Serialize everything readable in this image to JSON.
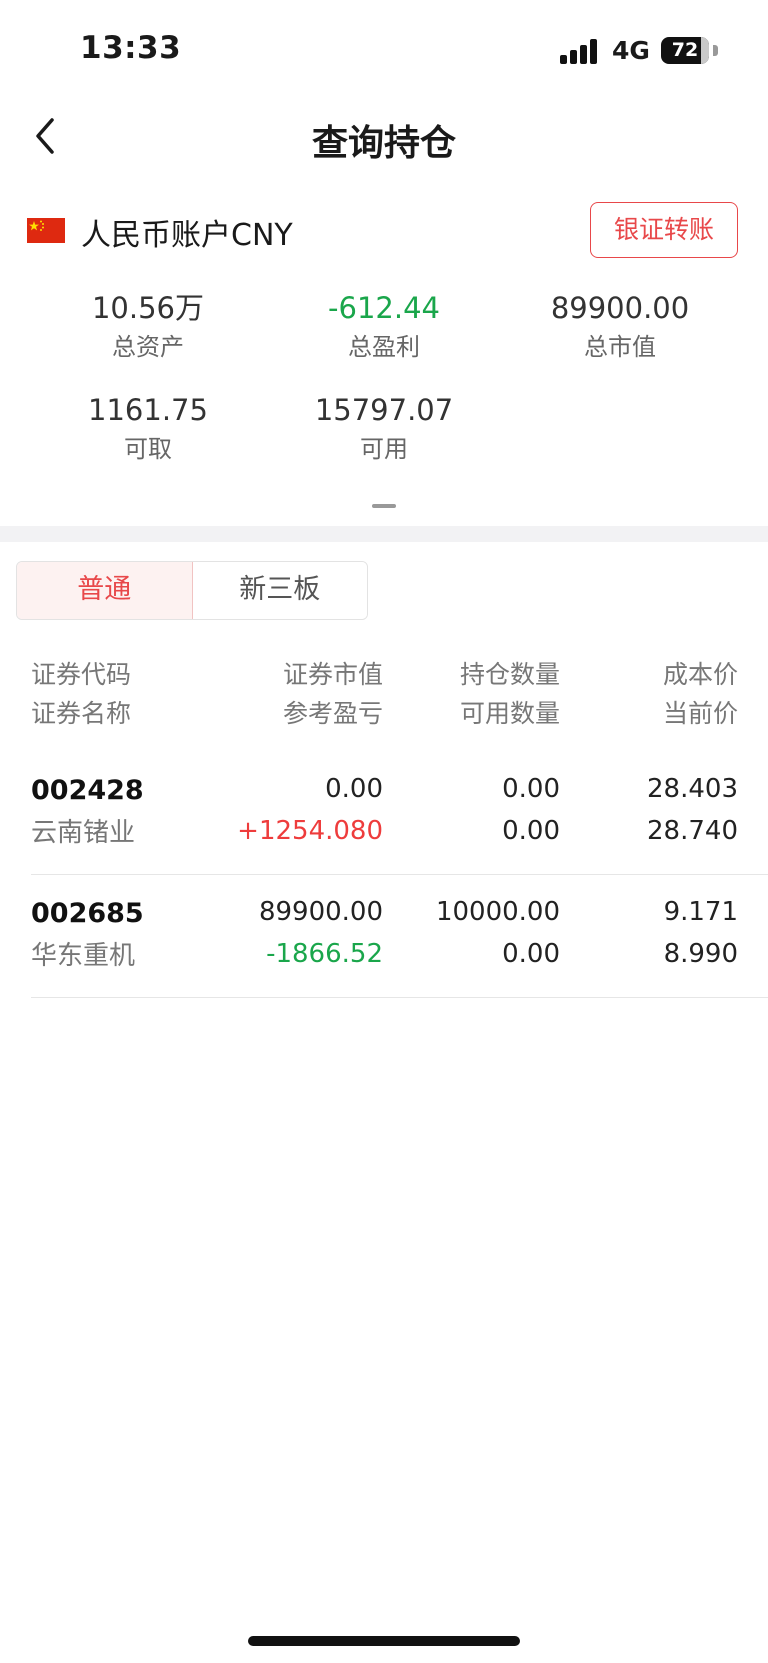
{
  "status_bar": {
    "time": "13:33",
    "network": "4G",
    "battery": "72"
  },
  "header": {
    "title": "查询持仓"
  },
  "account": {
    "name": "人民币账户CNY",
    "transfer_button": "银证转账",
    "stats": [
      {
        "value": "10.56万",
        "label": "总资产",
        "color": "#333333"
      },
      {
        "value": "-612.44",
        "label": "总盈利",
        "color": "#1aa64b"
      },
      {
        "value": "89900.00",
        "label": "总市值",
        "color": "#333333"
      },
      {
        "value": "1161.75",
        "label": "可取",
        "color": "#333333"
      },
      {
        "value": "15797.07",
        "label": "可用",
        "color": "#333333"
      }
    ]
  },
  "tabs": [
    {
      "label": "普通",
      "active": true
    },
    {
      "label": "新三板",
      "active": false
    }
  ],
  "table": {
    "headers": {
      "col1": [
        "证券代码",
        "证券名称"
      ],
      "col2": [
        "证券市值",
        "参考盈亏"
      ],
      "col3": [
        "持仓数量",
        "可用数量"
      ],
      "col4": [
        "成本价",
        "当前价"
      ]
    },
    "rows": [
      {
        "code": "002428",
        "name": "云南锗业",
        "market_value": "0.00",
        "profit": "+1254.080",
        "profit_color": "#ee3c3c",
        "holding_qty": "0.00",
        "available_qty": "0.00",
        "cost_price": "28.403",
        "current_price": "28.740"
      },
      {
        "code": "002685",
        "name": "华东重机",
        "market_value": "89900.00",
        "profit": "-1866.52",
        "profit_color": "#1aa64b",
        "holding_qty": "10000.00",
        "available_qty": "0.00",
        "cost_price": "9.171",
        "current_price": "8.990"
      }
    ]
  },
  "colors": {
    "accent_red": "#e8484a",
    "gain_red": "#ee3c3c",
    "loss_green": "#1aa64b"
  }
}
